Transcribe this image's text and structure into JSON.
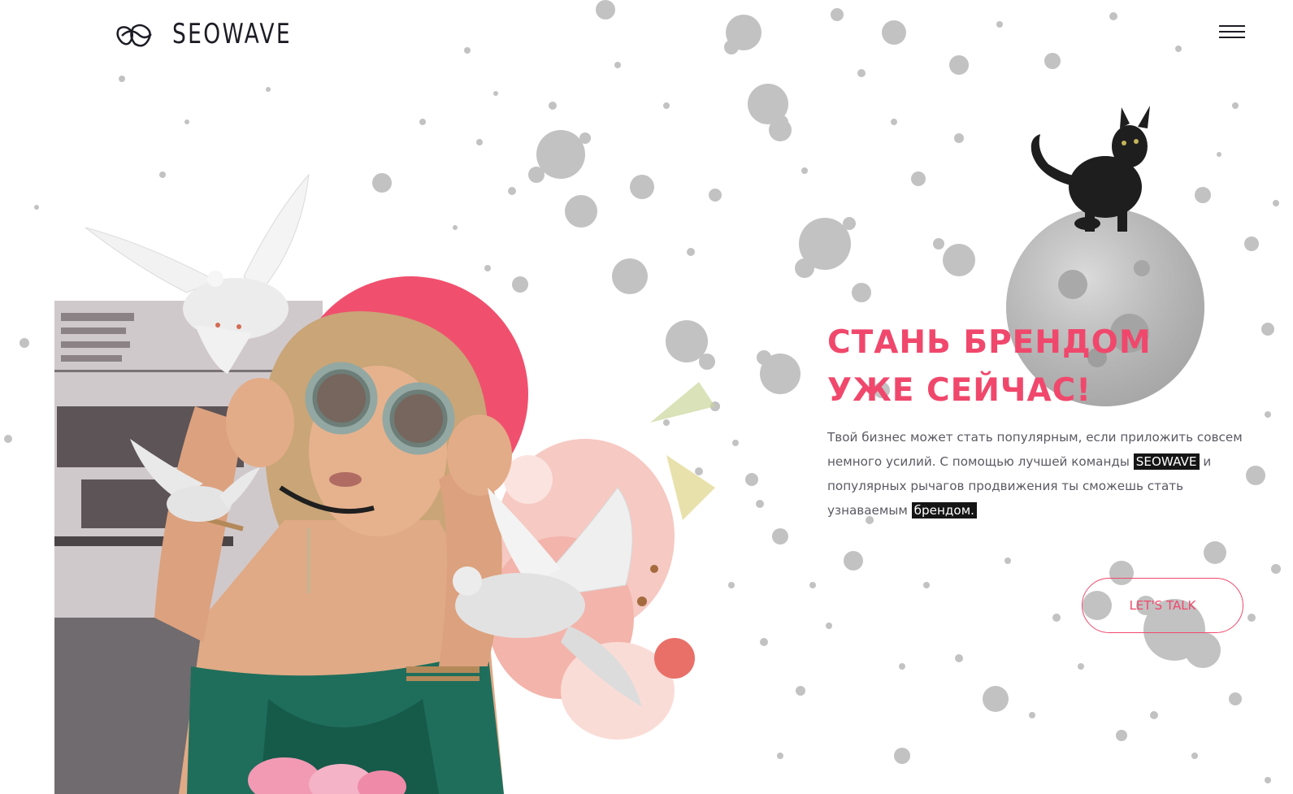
{
  "header": {
    "logo_text": "SEOWAVE",
    "menu_icon": "hamburger-icon"
  },
  "hero": {
    "title_line1": "СТАНЬ БРЕНДОМ",
    "title_line2": "УЖЕ СЕЙЧАС!",
    "description_part1": "Твой бизнес может стать популярным, если приложить совсем немного усилий. С помощью лучшей команды ",
    "highlight_brand": "SEOWAVE",
    "description_part2": " и популярных рычагов продвижения ты сможешь стать узнаваемым ",
    "highlight_word": "брендом.",
    "cta_label": "LET'S TALK"
  },
  "colors": {
    "accent": "#f0486c",
    "text": "#5a5a62",
    "logo": "#1c1c24",
    "splatter": "#bdbdbd",
    "highlight_bg": "#151515"
  }
}
